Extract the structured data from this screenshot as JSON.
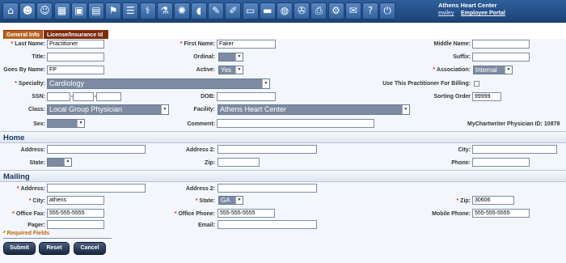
{
  "toolbar": {
    "icons": [
      "home-icon",
      "patients-icon",
      "practitioners-icon",
      "reports-icon",
      "chart-icon",
      "calendar-icon",
      "flag-icon",
      "document-icon",
      "stethoscope-icon",
      "lab-flask-icon",
      "sun-icon",
      "pill-icon",
      "syringe-icon",
      "pen-icon",
      "card-icon",
      "folder-icon",
      "globe-icon",
      "network-icon",
      "printer-icon",
      "gear-icon",
      "mail-icon",
      "help-icon",
      "power-icon"
    ],
    "glyphs": [
      "⌂",
      "☻",
      "☺",
      "▦",
      "▣",
      "▤",
      "⚑",
      "☰",
      "⚕",
      "⚗",
      "✺",
      "◖",
      "✎",
      "✐",
      "▭",
      "▬",
      "◍",
      "✇",
      "⎙",
      "⚙",
      "✉",
      "?",
      "⏻"
    ],
    "org_name": "Athens Heart Center",
    "username": "ewiley",
    "portal_link": "Employee Portal"
  },
  "tabs": {
    "general": "General Info",
    "license": "License/Insurance Id"
  },
  "form": {
    "last_name_label": "Last Name:",
    "last_name": "Practitioner",
    "first_name_label": "First Name:",
    "first_name": "Faker",
    "middle_name_label": "Middle Name:",
    "middle_name": "",
    "title_label": "Title:",
    "title": "",
    "ordinal_label": "Ordinal:",
    "ordinal": "",
    "suffix_label": "Suffix:",
    "suffix": "",
    "goes_by_label": "Goes By Name:",
    "goes_by": "FP",
    "active_label": "Active:",
    "active": "Yes",
    "association_label": "Association:",
    "association": "Internal",
    "specialty_label": "Specialty:",
    "specialty": "Cardiology",
    "billing_label": "Use This Practitioner For Billing:",
    "ssn_label": "SSN:",
    "ssn1": "",
    "ssn2": "",
    "ssn3": "",
    "dob_label": "DOB:",
    "dob": "",
    "sorting_label": "Sorting Order",
    "sorting": "99999",
    "class_label": "Class:",
    "class": "Local Group Physician",
    "facility_label": "Facility:",
    "facility": "Athens Heart Center",
    "sex_label": "Sex:",
    "sex": "",
    "comment_label": "Comment:",
    "comment": "",
    "physician_id": "MyChartwriter Physician ID: 10879"
  },
  "home": {
    "heading": "Home",
    "address_label": "Address:",
    "address": "",
    "address2_label": "Address 2:",
    "address2": "",
    "city_label": "City:",
    "city": "",
    "state_label": "State:",
    "state": "",
    "zip_label": "Zip:",
    "zip": "",
    "phone_label": "Phone:",
    "phone": ""
  },
  "mailing": {
    "heading": "Mailing",
    "address_label": "Address:",
    "address": "",
    "address2_label": "Address 2:",
    "address2": "",
    "city_label": "City:",
    "city": "athens",
    "state_label": "State:",
    "state": "GA",
    "zip_label": "Zip:",
    "zip": "30606",
    "office_fax_label": "Office Fax:",
    "office_fax": "555-555-5555",
    "office_phone_label": "Office Phone:",
    "office_phone": "555-555-5555",
    "mobile_label": "Mobile Phone:",
    "mobile": "555-555-5555",
    "pager_label": "Pager:",
    "pager": "",
    "email_label": "Email:",
    "email": ""
  },
  "footer": {
    "required_note": "* Required Fields",
    "submit": "Submit",
    "reset": "Reset",
    "cancel": "Cancel"
  }
}
